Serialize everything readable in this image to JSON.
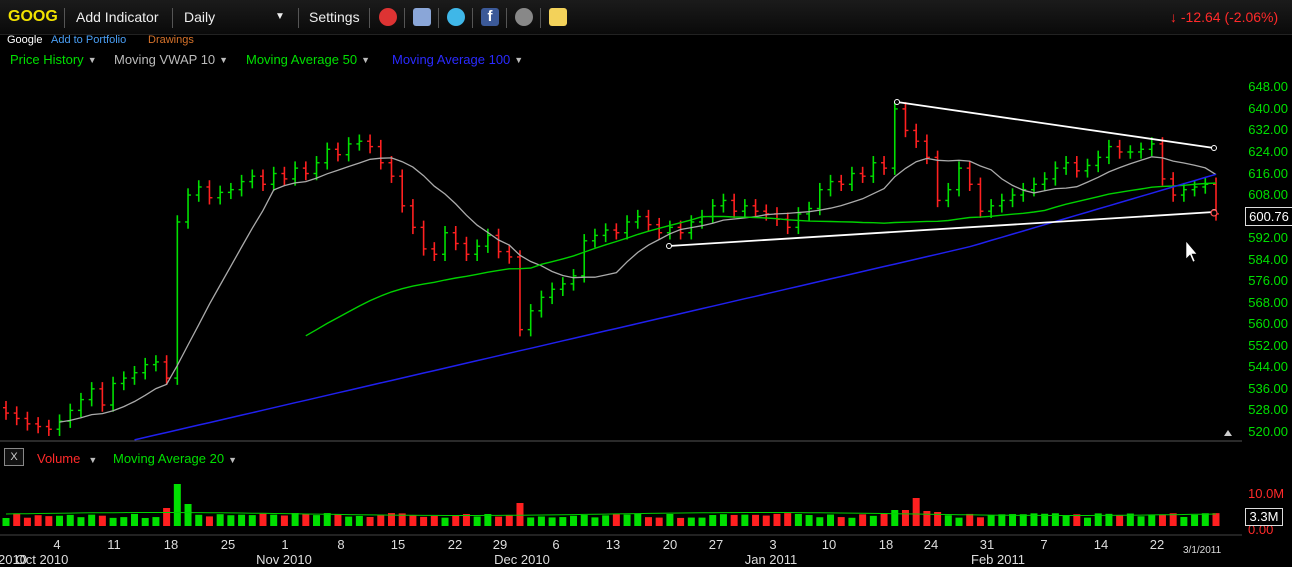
{
  "toolbar": {
    "ticker": "GOOG",
    "add_indicator": "Add Indicator",
    "interval": "Daily",
    "settings": "Settings",
    "change": "-12.64 (-2.06%)"
  },
  "subheader": {
    "company": "Google",
    "add_to_portfolio": "Add to Portfolio",
    "drawings": "Drawings"
  },
  "indicators": [
    {
      "label": "Price History",
      "color": "#00e000"
    },
    {
      "label": "Moving VWAP 10",
      "color": "#bbbbbb"
    },
    {
      "label": "Moving Average 50",
      "color": "#00e000"
    },
    {
      "label": "Moving Average 100",
      "color": "#2222ff"
    }
  ],
  "volume_panel": {
    "close_label": "X",
    "volume_label": "Volume",
    "ma_label": "Moving Average 20",
    "current_volume": "3.3M",
    "axis_top": "10.0M",
    "axis_bottom": "0.00"
  },
  "colors": {
    "up": "#00e000",
    "down": "#ff2020",
    "vwap": "#aaaaaa",
    "ma50": "#00d000",
    "ma100": "#2020ee"
  },
  "chart_data": {
    "type": "ohlc",
    "y_ticks": [
      "648.00",
      "640.00",
      "632.00",
      "624.00",
      "616.00",
      "608.00",
      "592.00",
      "584.00",
      "576.00",
      "568.00",
      "560.00",
      "552.00",
      "544.00",
      "536.00",
      "528.00",
      "520.00"
    ],
    "ylim": [
      517,
      650
    ],
    "current_price": "600.76",
    "day_labels": [
      "4",
      "11",
      "18",
      "25",
      "1",
      "8",
      "15",
      "22",
      "29",
      "6",
      "13",
      "20",
      "27",
      "3",
      "10",
      "18",
      "24",
      "31",
      "7",
      "14",
      "22"
    ],
    "month_labels": [
      "Oct 2010",
      "Nov 2010",
      "Dec 2010",
      "Jan 2011",
      "Feb 2011"
    ],
    "last_date": "3/1/2011",
    "year_fragment": "2010",
    "close": [
      527,
      525,
      523,
      522,
      521,
      524,
      528,
      532,
      536,
      530,
      538,
      540,
      542,
      545,
      546,
      540,
      598,
      608,
      611,
      607,
      609,
      610,
      613,
      615,
      612,
      616,
      614,
      618,
      616,
      620,
      625,
      623,
      627,
      628,
      626,
      620,
      615,
      604,
      596,
      588,
      586,
      594,
      590,
      586,
      589,
      593,
      587,
      585,
      558,
      565,
      570,
      573,
      575,
      578,
      591,
      593,
      595,
      594,
      598,
      600,
      597,
      594,
      596,
      594,
      598,
      600,
      604,
      606,
      602,
      604,
      602,
      601,
      599,
      596,
      601,
      603,
      610,
      613,
      612,
      616,
      615,
      620,
      618,
      640,
      632,
      628,
      622,
      606,
      610,
      618,
      612,
      602,
      604,
      606,
      608,
      610,
      612,
      614,
      618,
      620,
      617,
      619,
      622,
      626,
      624,
      624,
      625,
      627,
      614,
      608,
      610,
      611,
      612,
      601
    ]
  }
}
